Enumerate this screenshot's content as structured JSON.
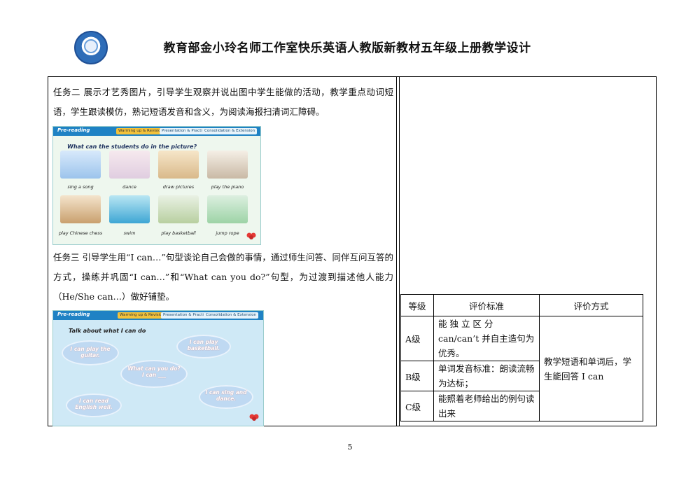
{
  "header": {
    "title": "教育部金小玲名师工作室快乐英语人教版新教材五年级上册教学设计"
  },
  "content": {
    "task2": "任务二 展示才艺秀图片，引导学生观察并说出图中学生能做的活动，教学重点动词短语，学生跟读模仿，熟记短语发音和含义，为阅读海报扫清词汇障碍。",
    "task3": "任务三 引导学生用“I can…”句型谈论自己会做的事情，通过师生问答、同伴互问互答的方式，操练并巩固“I can…”和“What can you do?”句型，为过渡到描述他人能力（He/She can…）做好铺垫。"
  },
  "slide1": {
    "label": "Pre-reading",
    "pills": [
      "Warming up & Revision",
      "Presentation & Practice",
      "Consolidation & Extension"
    ],
    "question": "What can the students do in the picture?",
    "captions": [
      "sing a song",
      "dance",
      "draw pictures",
      "play the piano",
      "play Chinese chess",
      "swim",
      "play basketball",
      "jump rope"
    ]
  },
  "slide2": {
    "label": "Pre-reading",
    "pills": [
      "Warming up & Revision",
      "Presentation & Practice",
      "Consolidation & Extension"
    ],
    "heading": "Talk about what I can do",
    "bubbles": [
      "I can play the guitar.",
      "I can play basketball.",
      "What can you do?   I can ___",
      "I can read English well.",
      "I can sing and dance."
    ]
  },
  "evaluation": {
    "headers": [
      "等级",
      "评价标准",
      "评价方式"
    ],
    "rows": [
      {
        "grade": "A级",
        "criteria": "能 独 立 区 分 can/can’t 并自主造句为优秀。"
      },
      {
        "grade": "B级",
        "criteria": "单词发音标准：朗读流畅为达标；"
      },
      {
        "grade": "C级",
        "criteria": "能照着老师给出的例句读出来"
      }
    ],
    "method": "教学短语和单词后，学生能回答 I can"
  },
  "footer": {
    "page_number": "5"
  },
  "colors": {
    "slide_bar": "#1f82c4",
    "pill_active": "#f3c23a",
    "bubble": "#bfd9f2"
  }
}
